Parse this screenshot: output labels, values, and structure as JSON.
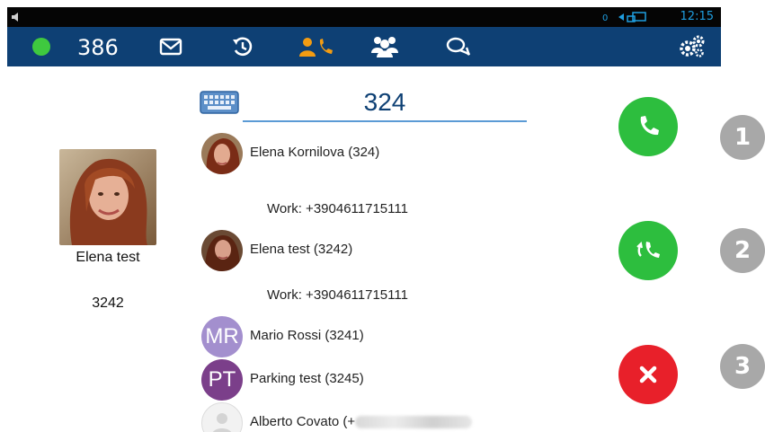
{
  "status_bar": {
    "time": "12:15"
  },
  "nav": {
    "extension": "386",
    "colors": {
      "bar": "#0e4074",
      "active": "#f39c12",
      "icon": "#ffffff",
      "presence": "#3fc93f"
    },
    "items": [
      {
        "icon": "mail-icon",
        "active": false
      },
      {
        "icon": "history-icon",
        "active": false
      },
      {
        "icon": "contact-call-icon",
        "active": true
      },
      {
        "icon": "group-icon",
        "active": false
      },
      {
        "icon": "chat-icon",
        "active": false
      },
      {
        "icon": "settings-gears-icon",
        "active": false
      }
    ]
  },
  "selected_contact": {
    "name": "Elena test",
    "number": "3242"
  },
  "dialer": {
    "input_value": "324",
    "keyboard_icon": "keyboard-icon"
  },
  "results": [
    {
      "name": "Elena Kornilova (324)",
      "work": "Work: +3904611715111",
      "avatar": "photo"
    },
    {
      "name": "Elena test (3242)",
      "work": "Work: +3904611715111",
      "avatar": "photo"
    },
    {
      "name": "Mario Rossi (3241)",
      "initials": "MR",
      "avatar_color": "#a38fce"
    },
    {
      "name": "Parking test (3245)",
      "initials": "PT",
      "avatar_color": "#7b3f8a"
    },
    {
      "name": "Alberto Covato (+",
      "avatar": "placeholder"
    }
  ],
  "actions": [
    {
      "icon": "phone-icon",
      "color": "#2dbe3e",
      "badge": "1"
    },
    {
      "icon": "transfer-call-icon",
      "color": "#2dbe3e",
      "badge": "2"
    },
    {
      "icon": "close-icon",
      "color": "#e8202a",
      "badge": "3"
    }
  ]
}
